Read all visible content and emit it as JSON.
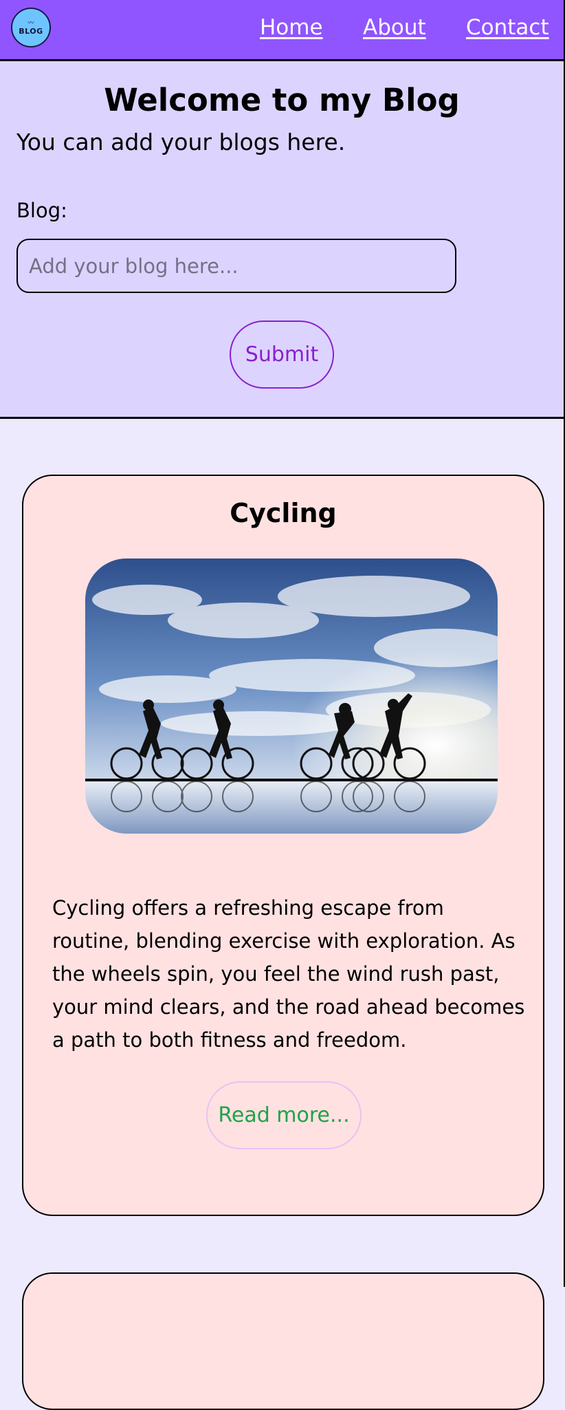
{
  "nav": {
    "logo_text": "BLOG",
    "links": [
      "Home",
      "About",
      "Contact"
    ]
  },
  "hero": {
    "title": "Welcome to my Blog",
    "subtitle": "You can add your blogs here.",
    "blog_label": "Blog:",
    "blog_placeholder": "Add your blog here...",
    "blog_value": "",
    "submit_label": "Submit"
  },
  "posts": [
    {
      "title": "Cycling",
      "image": "cyclists-silhouette-sky-photo",
      "text": "Cycling offers a refreshing escape from routine, blending exercise with exploration. As the wheels spin, you feel the wind rush past, your mind clears, and the road ahead becomes a path to both fitness and freedom.",
      "read_more_label": "Read more..."
    }
  ],
  "colors": {
    "nav_bg": "#9055ff",
    "hero_bg": "#dcd4ff",
    "page_bg": "#edeafe",
    "card_bg": "#ffe1e1",
    "submit_accent": "#8a1fcf",
    "read_more_text": "#1ea34a"
  }
}
